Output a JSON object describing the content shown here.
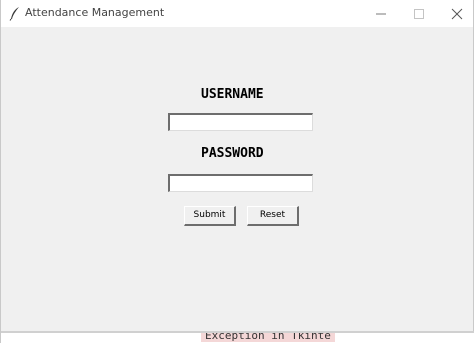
{
  "window": {
    "title": "Attendance Management",
    "icons": {
      "app": "feather-icon",
      "minimize": "minimize-icon",
      "maximize": "maximize-icon",
      "close": "close-icon"
    }
  },
  "form": {
    "username_label": "USERNAME",
    "username_value": "",
    "password_label": "PASSWORD",
    "password_value": "",
    "submit_label": "Submit",
    "reset_label": "Reset"
  },
  "background": {
    "bottom_text": "Exception in Tkinte"
  }
}
